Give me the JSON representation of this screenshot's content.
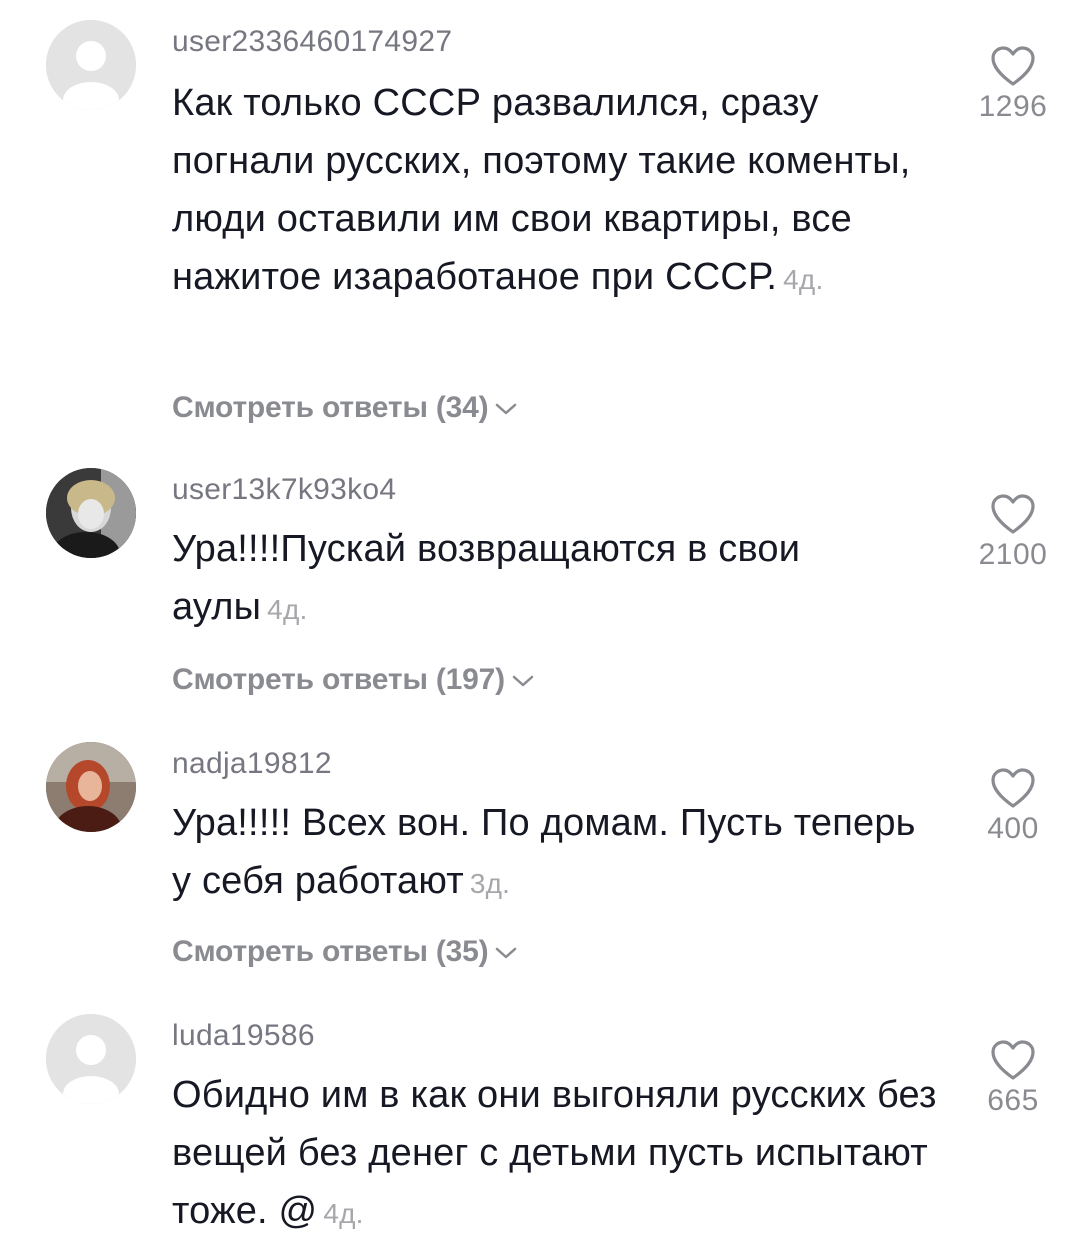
{
  "comments": [
    {
      "username": "user2336460174927",
      "text": "Как только СССР развалился, сразу погнали русских, поэтому такие коменты, люди оставили им свои квартиры, все нажитое изаработаное при СССР.",
      "time": "4д.",
      "replies": "Смотреть ответы (34)",
      "likes": "1296",
      "avatar": "default-avatar-icon"
    },
    {
      "username": "user13k7k93ko4",
      "text": "Ура!!!!Пускай возвращаются в свои аулы",
      "time": "4д.",
      "replies": "Смотреть ответы (197)",
      "likes": "2100",
      "avatar": "photo-avatar"
    },
    {
      "username": "nadja19812",
      "text": "Ура!!!!! Всех вон. По домам. Пусть теперь у себя работают",
      "time": "3д.",
      "replies": "Смотреть ответы (35)",
      "likes": "400",
      "avatar": "photo-avatar"
    },
    {
      "username": "luda19586",
      "text": "Обидно им в как они выгоняли русских без вещей без денег с детьми пусть испытают тоже. @",
      "time": "4д.",
      "likes": "665",
      "avatar": "default-avatar-icon"
    }
  ],
  "colors": {
    "text": "#161823",
    "muted": "#8a8b91",
    "time": "#a7a7ab",
    "avatar_bg": "#e3e3e4"
  }
}
